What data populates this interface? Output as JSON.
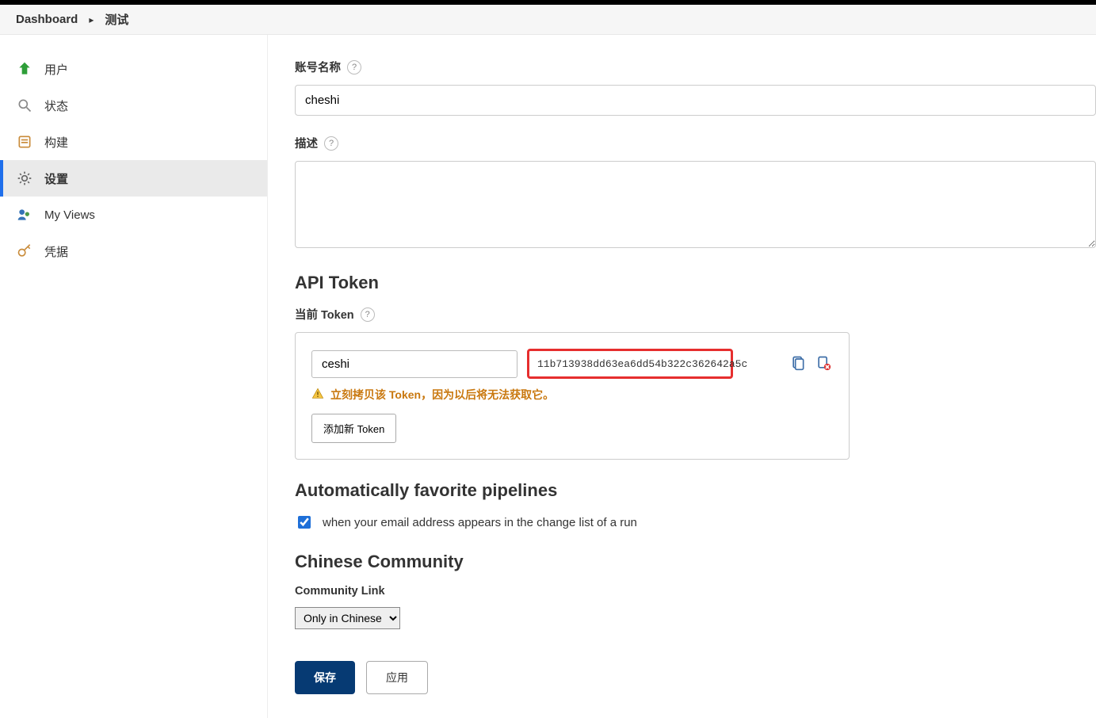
{
  "breadcrumb": {
    "root": "Dashboard",
    "current": "测试"
  },
  "sidebar": {
    "items": [
      {
        "label": "用户"
      },
      {
        "label": "状态"
      },
      {
        "label": "构建"
      },
      {
        "label": "设置"
      },
      {
        "label": "My Views"
      },
      {
        "label": "凭据"
      }
    ]
  },
  "form": {
    "account_name_label": "账号名称",
    "account_name_value": "cheshi",
    "description_label": "描述",
    "description_value": ""
  },
  "api_token": {
    "heading": "API Token",
    "current_label": "当前 Token",
    "name_value": "ceshi",
    "token_value": "11b713938dd63ea6dd54b322c362642a5c",
    "warning": "立刻拷贝该 Token，因为以后将无法获取它。",
    "add_button": "添加新 Token"
  },
  "favorites": {
    "heading": "Automatically favorite pipelines",
    "checkbox_checked": true,
    "checkbox_label": "when your email address appears in the change list of a run"
  },
  "community": {
    "heading": "Chinese Community",
    "link_label": "Community Link",
    "selected_option": "Only in Chinese"
  },
  "buttons": {
    "save": "保存",
    "apply": "应用"
  }
}
